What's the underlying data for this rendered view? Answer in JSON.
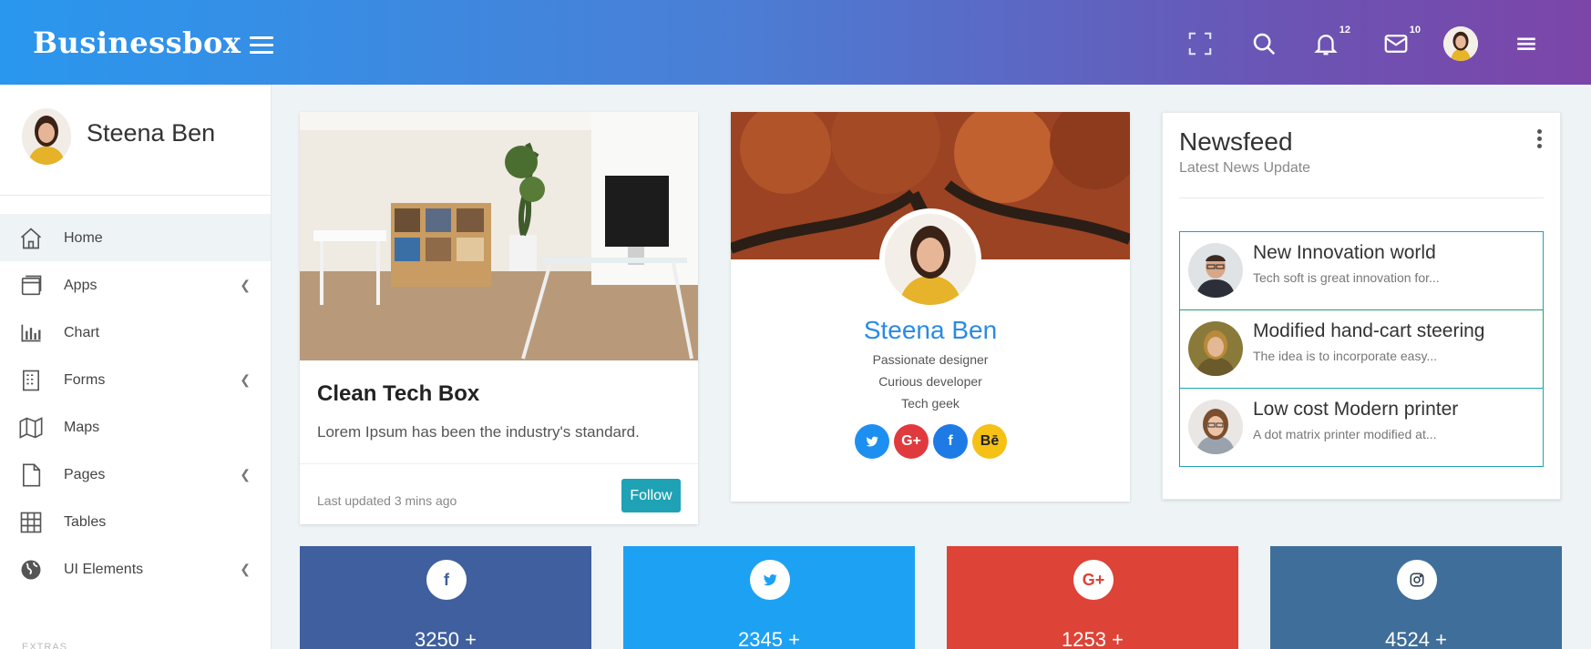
{
  "brand": {
    "name": "Businessbox"
  },
  "header": {
    "notifications_count": "12",
    "messages_count": "10"
  },
  "user": {
    "name": "Steena Ben"
  },
  "sidebar": {
    "items": [
      {
        "label": "Home",
        "icon": "home-icon",
        "active": true,
        "has_submenu": false
      },
      {
        "label": "Apps",
        "icon": "apps-icon",
        "has_submenu": true
      },
      {
        "label": "Chart",
        "icon": "chart-icon",
        "has_submenu": false
      },
      {
        "label": "Forms",
        "icon": "forms-icon",
        "has_submenu": true
      },
      {
        "label": "Maps",
        "icon": "map-icon",
        "has_submenu": false
      },
      {
        "label": "Pages",
        "icon": "page-icon",
        "has_submenu": true
      },
      {
        "label": "Tables",
        "icon": "table-icon",
        "has_submenu": false
      },
      {
        "label": "UI Elements",
        "icon": "globe-icon",
        "has_submenu": true
      }
    ],
    "extras_label": "EXTRAS"
  },
  "card_tech": {
    "title": "Clean Tech Box",
    "text": "Lorem Ipsum has been the industry's standard.",
    "updated": "Last updated 3 mins ago",
    "follow_label": "Follow"
  },
  "card_profile": {
    "name": "Steena Ben",
    "lines": [
      "Passionate designer",
      "Curious developer",
      "Tech geek"
    ],
    "socials": [
      {
        "icon": "twitter-icon",
        "glyph": "t",
        "color": "#1d8ff0"
      },
      {
        "icon": "google-plus-icon",
        "glyph": "G+",
        "color": "#e03a3e"
      },
      {
        "icon": "facebook-icon",
        "glyph": "f",
        "color": "#1e7be6"
      },
      {
        "icon": "behance-icon",
        "glyph": "Bē",
        "color": "#f5c115"
      }
    ]
  },
  "newsfeed": {
    "title": "Newsfeed",
    "subtitle": "Latest News Update",
    "items": [
      {
        "title": "New Innovation world",
        "desc": "Tech soft is great innovation for..."
      },
      {
        "title": "Modified hand-cart steering",
        "desc": "The idea is to incorporate easy..."
      },
      {
        "title": "Low cost Modern printer",
        "desc": "A dot matrix printer modified at..."
      }
    ]
  },
  "stats": [
    {
      "network": "facebook",
      "icon": "facebook-icon",
      "glyph": "f",
      "value": "3250 +",
      "color": "#3f5f9e"
    },
    {
      "network": "twitter",
      "icon": "twitter-icon",
      "glyph": "t",
      "value": "2345 +",
      "color": "#1da1f2"
    },
    {
      "network": "google-plus",
      "icon": "google-plus-icon",
      "glyph": "G+",
      "value": "1253 +",
      "color": "#dd4337"
    },
    {
      "network": "instagram",
      "icon": "instagram-icon",
      "glyph": "◎",
      "value": "4524 +",
      "color": "#3f6e9a"
    }
  ]
}
